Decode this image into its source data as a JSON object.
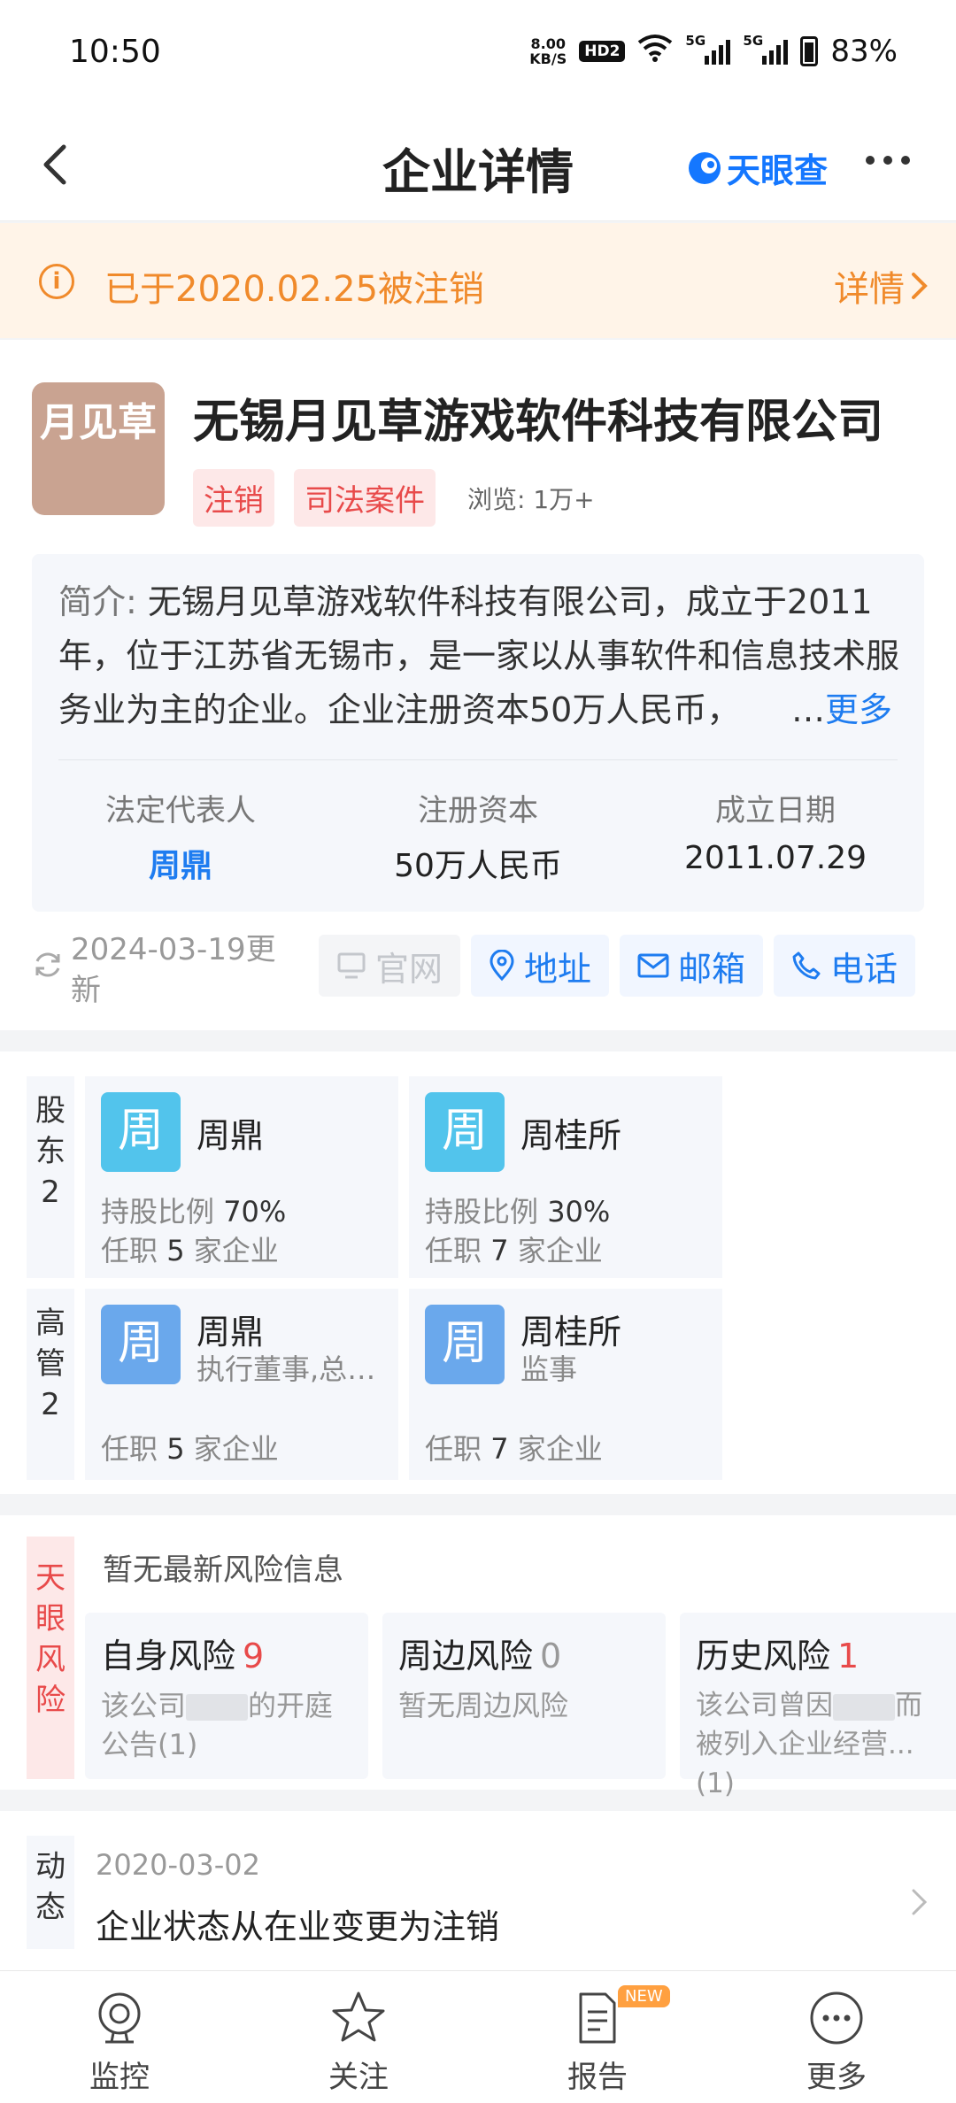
{
  "status_bar": {
    "time": "10:50",
    "net_speed_value": "8.00",
    "net_speed_unit": "KB/S",
    "hd": "HD2",
    "sig1_label": "5G",
    "sig2_label": "5G",
    "battery": "83%"
  },
  "nav": {
    "title": "企业详情",
    "brand": "天眼查"
  },
  "notice": {
    "text": "已于2020.02.25被注销",
    "detail": "详情"
  },
  "company": {
    "logo_text": "月见草",
    "name": "无锡月见草游戏软件科技有限公司",
    "tags": [
      "注销",
      "司法案件"
    ],
    "views": "浏览: 1万+",
    "intro_label": "简介: ",
    "intro": "无锡月见草游戏软件科技有限公司，成立于2011年，位于江苏省无锡市，是一家以从事软件和信息技术服务业为主的企业。企业注册资本50万人民币，",
    "more": "更多",
    "stats": [
      {
        "label": "法定代表人",
        "value": "周鼎"
      },
      {
        "label": "注册资本",
        "value": "50万人民币"
      },
      {
        "label": "成立日期",
        "value": "2011.07.29"
      }
    ],
    "updated": "2024-03-19更新",
    "contacts": [
      "官网",
      "地址",
      "邮箱",
      "电话"
    ]
  },
  "shareholders": {
    "label": "股东2",
    "items": [
      {
        "avatar": "周",
        "name": "周鼎",
        "ratio_label": "持股比例",
        "ratio": "70%",
        "job_pre": "任职",
        "job_count": "5",
        "job_post": "家企业"
      },
      {
        "avatar": "周",
        "name": "周桂所",
        "ratio_label": "持股比例",
        "ratio": "30%",
        "job_pre": "任职",
        "job_count": "7",
        "job_post": "家企业"
      }
    ]
  },
  "executives": {
    "label": "高管2",
    "items": [
      {
        "avatar": "周",
        "name": "周鼎",
        "role": "执行董事,总经理",
        "job_pre": "任职",
        "job_count": "5",
        "job_post": "家企业"
      },
      {
        "avatar": "周",
        "name": "周桂所",
        "role": "监事",
        "job_pre": "任职",
        "job_count": "7",
        "job_post": "家企业"
      }
    ]
  },
  "risk": {
    "label": "天眼风险",
    "head": "暂无最新风险信息",
    "cards": [
      {
        "title": "自身风险",
        "count": "9",
        "desc_a": "该公司",
        "desc_b": "的开庭公告(1)"
      },
      {
        "title": "周边风险",
        "count": "0",
        "desc": "暂无周边风险"
      },
      {
        "title": "历史风险",
        "count": "1",
        "desc_a": "该公司曾因",
        "desc_b": "而被列入企业经营...(1)"
      }
    ]
  },
  "dynamics": {
    "label": "动态",
    "date": "2020-03-02",
    "text": "企业状态从在业变更为注销"
  },
  "tabs": [
    {
      "label": "监控",
      "icon": "monitor-icon"
    },
    {
      "label": "关注",
      "icon": "star-icon"
    },
    {
      "label": "报告",
      "icon": "report-icon",
      "badge": "NEW"
    },
    {
      "label": "更多",
      "icon": "more-icon"
    }
  ],
  "colors": {
    "accent": "#1e7cf0",
    "warning": "#f08a2b",
    "danger": "#e84a4a",
    "logo_bg": "#c9a391"
  }
}
